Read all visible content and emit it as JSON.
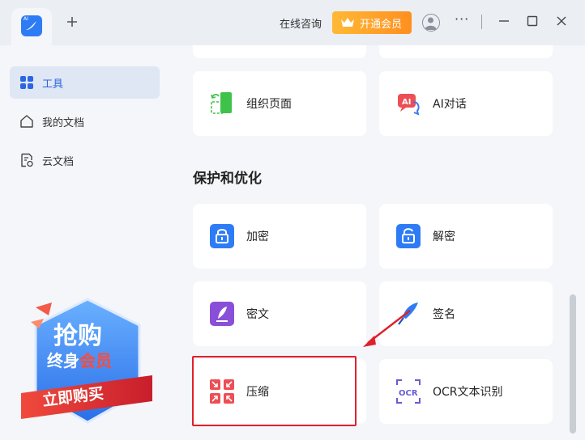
{
  "titlebar": {
    "consult_label": "在线咨询",
    "vip_label": "开通会员",
    "logo_badge": "AI"
  },
  "sidebar": {
    "items": [
      {
        "label": "工具",
        "icon": "grid-icon",
        "active": true
      },
      {
        "label": "我的文档",
        "icon": "home-icon",
        "active": false
      },
      {
        "label": "云文档",
        "icon": "cloud-doc-icon",
        "active": false
      }
    ],
    "promo": {
      "line1": "抢购",
      "line2a": "终身",
      "line2b": "会员",
      "button": "立即购买"
    }
  },
  "main": {
    "section_title": "保护和优化",
    "cards": [
      {
        "label": "组织页面",
        "icon": "organize-pages-icon"
      },
      {
        "label": "AI对话",
        "icon": "ai-chat-icon"
      },
      {
        "label": "加密",
        "icon": "lock-icon"
      },
      {
        "label": "解密",
        "icon": "unlock-icon"
      },
      {
        "label": "密文",
        "icon": "quill-doc-icon"
      },
      {
        "label": "签名",
        "icon": "feather-pen-icon"
      },
      {
        "label": "压缩",
        "icon": "compress-icon"
      },
      {
        "label": "OCR文本识别",
        "icon": "ocr-icon"
      }
    ]
  },
  "colors": {
    "accent": "#2d7cf6",
    "vip": "#ff9a22",
    "annotation": "#e0202a"
  }
}
